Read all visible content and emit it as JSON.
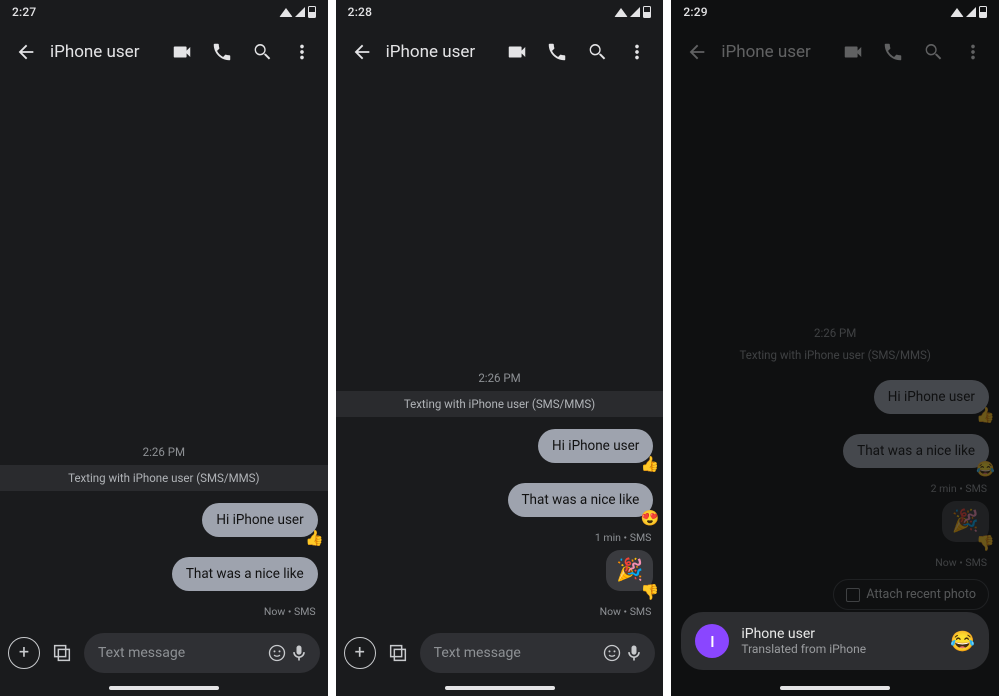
{
  "screens": [
    {
      "clock": "2:27",
      "title": "iPhone user",
      "timestamp": "2:26 PM",
      "banner": "Texting with iPhone user (SMS/MMS)",
      "msg1": "Hi iPhone user",
      "react1": "👍",
      "msg2": "That was a nice like",
      "meta2": "Now • SMS",
      "composer_placeholder": "Text message"
    },
    {
      "clock": "2:28",
      "title": "iPhone user",
      "timestamp": "2:26 PM",
      "banner": "Texting with iPhone user (SMS/MMS)",
      "msg1": "Hi iPhone user",
      "react1": "👍",
      "msg2": "That was a nice like",
      "react2": "😍",
      "meta2": "1 min • SMS",
      "sticker": "🎉",
      "react3": "👎",
      "meta3": "Now • SMS",
      "composer_placeholder": "Text message"
    },
    {
      "clock": "2:29",
      "title": "iPhone user",
      "timestamp": "2:26 PM",
      "banner": "Texting with iPhone user (SMS/MMS)",
      "msg1": "Hi iPhone user",
      "react1": "👍",
      "msg2": "That was a nice like",
      "react2": "😂",
      "meta2": "2 min • SMS",
      "sticker": "🎉",
      "react3": "👎",
      "meta3": "Now • SMS",
      "chip": "Attach recent photo",
      "sheet_avatar": "I",
      "sheet_name": "iPhone user",
      "sheet_sub": "Translated from iPhone",
      "sheet_emoji": "😂"
    }
  ]
}
